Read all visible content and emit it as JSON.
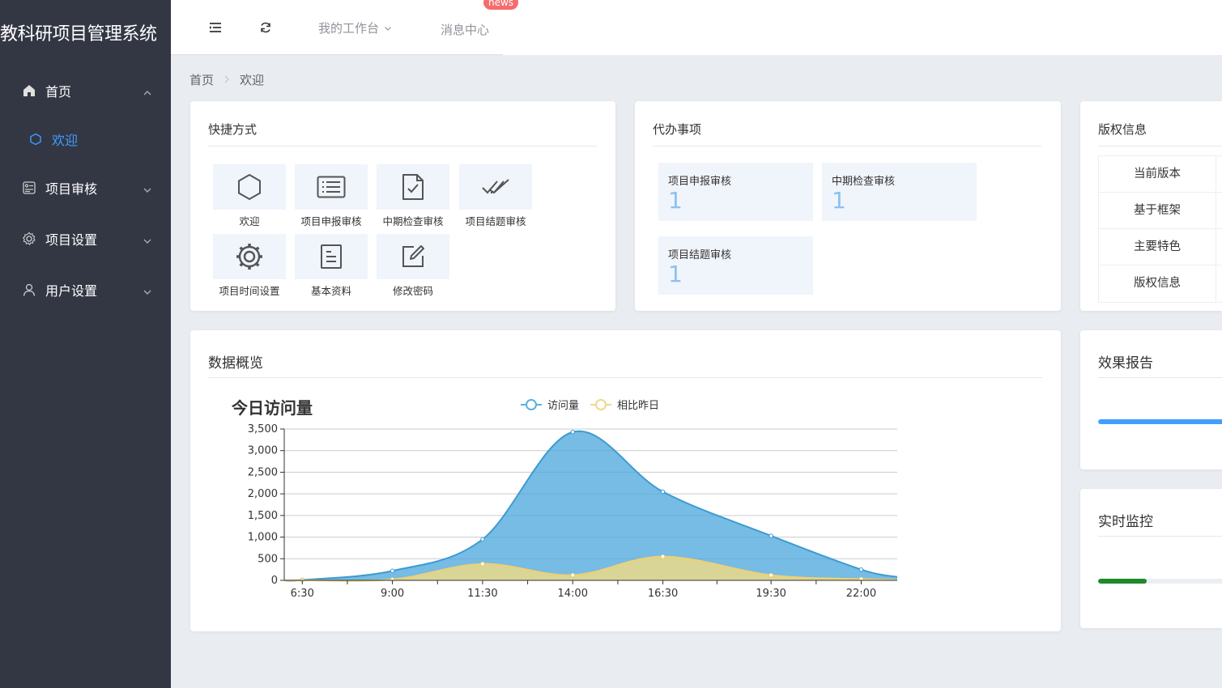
{
  "app": {
    "title": "教科研项目管理系统"
  },
  "sidebar": {
    "items": [
      {
        "label": "首页",
        "icon": "home-icon",
        "expanded": true
      },
      {
        "label": "项目审核",
        "icon": "audit-icon",
        "expanded": false
      },
      {
        "label": "项目设置",
        "icon": "gear-icon",
        "expanded": false
      },
      {
        "label": "用户设置",
        "icon": "user-icon",
        "expanded": false
      }
    ],
    "subitems": [
      {
        "label": "欢迎",
        "icon": "hexagon-icon"
      }
    ]
  },
  "topbar": {
    "workbench_label": "我的工作台",
    "messages_label": "消息中心",
    "messages_badge": "news"
  },
  "breadcrumb": {
    "home": "首页",
    "current": "欢迎"
  },
  "shortcuts": {
    "title": "快捷方式",
    "items": [
      {
        "label": "欢迎",
        "icon": "hexagon-icon"
      },
      {
        "label": "项目申报审核",
        "icon": "list-icon"
      },
      {
        "label": "中期检查审核",
        "icon": "file-check-icon"
      },
      {
        "label": "项目结题审核",
        "icon": "double-check-icon"
      },
      {
        "label": "项目时间设置",
        "icon": "gear-icon"
      },
      {
        "label": "基本资料",
        "icon": "document-icon"
      },
      {
        "label": "修改密码",
        "icon": "edit-icon"
      }
    ]
  },
  "todo": {
    "title": "代办事项",
    "items": [
      {
        "label": "项目申报审核",
        "count": "1"
      },
      {
        "label": "中期检查审核",
        "count": "1"
      },
      {
        "label": "项目结题审核",
        "count": "1"
      }
    ]
  },
  "copyright": {
    "title": "版权信息",
    "rows": [
      "当前版本",
      "基于框架",
      "主要特色",
      "版权信息"
    ]
  },
  "overview": {
    "title": "数据概览"
  },
  "effect_report": {
    "title": "效果报告",
    "progress": 1.0,
    "color": "#409eff"
  },
  "monitor": {
    "title": "实时监控",
    "progress": 0.3,
    "color": "#1e8a2a"
  },
  "chart_data": {
    "type": "area",
    "title": "今日访问量",
    "categories": [
      "6:30",
      "9:00",
      "11:30",
      "14:00",
      "16:30",
      "19:30",
      "22:00"
    ],
    "ylim": [
      0,
      3500
    ],
    "yticks": [
      "0",
      "500",
      "1,000",
      "1,500",
      "2,000",
      "2,500",
      "3,000",
      "3,500"
    ],
    "x": [
      "6:00",
      "6:30",
      "9:00",
      "11:30",
      "14:00",
      "16:30",
      "19:30",
      "22:00",
      "23:00"
    ],
    "series": [
      {
        "name": "访问量",
        "color": "#5cb0e0",
        "values": [
          0,
          10,
          220,
          950,
          3430,
          2050,
          1030,
          250,
          80
        ]
      },
      {
        "name": "相比昨日",
        "color": "#f0d78a",
        "values": [
          0,
          5,
          20,
          380,
          120,
          550,
          120,
          30,
          10
        ]
      }
    ],
    "legend_position": "top",
    "grid": true
  }
}
